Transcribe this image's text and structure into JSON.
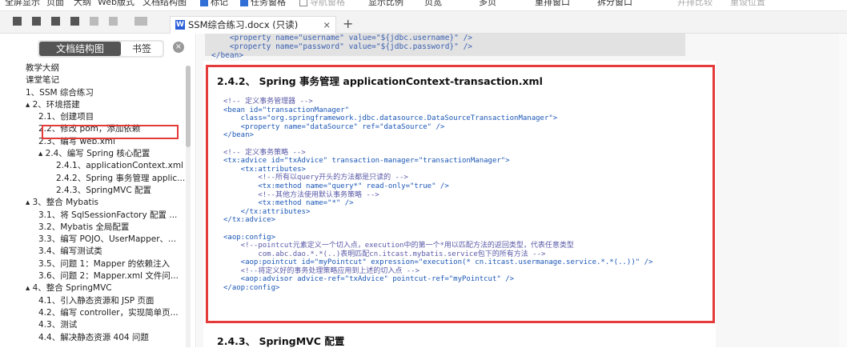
{
  "ribbon": {
    "items": [
      "全屏显示",
      "页面",
      "大纲",
      "Web版式",
      "文档结构图",
      "标记",
      "任务窗格",
      "导航窗格",
      "显示比例",
      "页宽",
      "多页",
      "重排窗口",
      "拆分窗口",
      "并排比较",
      "重设位置"
    ]
  },
  "tab": {
    "title": "SSM综合练习.docx (只读)",
    "close": "×",
    "add": "+"
  },
  "sidebar": {
    "seg_outline": "文档结构图",
    "seg_bookmark": "书签",
    "close": "×",
    "toc": [
      {
        "level": 1,
        "label": "教学大纲"
      },
      {
        "level": 1,
        "label": "课堂笔记"
      },
      {
        "level": 1,
        "label": "1、SSM 综合练习"
      },
      {
        "level": 1,
        "label": "▴ 2、环境搭建"
      },
      {
        "level": 2,
        "label": "2.1、创建项目"
      },
      {
        "level": 2,
        "label": "2.2、修改 pom，添加依赖"
      },
      {
        "level": 2,
        "label": "2.3、编写 web.xml"
      },
      {
        "level": 2,
        "label": "▴ 2.4、编写 Spring 核心配置"
      },
      {
        "level": 3,
        "label": "2.4.1、applicationContext.xml"
      },
      {
        "level": 3,
        "label": "2.4.2、Spring 事务管理 applic..."
      },
      {
        "level": 3,
        "label": "2.4.3、SpringMVC 配置"
      },
      {
        "level": 1,
        "label": "▴ 3、整合 Mybatis"
      },
      {
        "level": 2,
        "label": "3.1、将 SqlSessionFactory 配置 ..."
      },
      {
        "level": 2,
        "label": "3.2、Mybatis 全局配置"
      },
      {
        "level": 2,
        "label": "3.3、编写 POJO、UserMapper、..."
      },
      {
        "level": 2,
        "label": "3.4、编写测试类"
      },
      {
        "level": 2,
        "label": "3.5、问题 1：Mapper 的依赖注入"
      },
      {
        "level": 2,
        "label": "3.6、问题 2：Mapper.xml 文件问..."
      },
      {
        "level": 1,
        "label": "▴ 4、整合 SpringMVC"
      },
      {
        "level": 2,
        "label": "4.1、引入静态资源和 JSP 页面"
      },
      {
        "level": 2,
        "label": "4.2、编写 controller，实现简单页..."
      },
      {
        "level": 2,
        "label": "4.3、测试"
      },
      {
        "level": 2,
        "label": "4.4、解决静态资源 404 问题"
      }
    ]
  },
  "doc": {
    "top_lines": [
      "    <property name=\"username\" value=\"${jdbc.username}\" />",
      "    <property name=\"password\" value=\"${jdbc.password}\" />",
      "</bean>"
    ],
    "heading_242": "2.4.2、 Spring 事务管理 applicationContext-transaction.xml",
    "code_lines": [
      "<!-- 定义事务管理器 -->",
      "<bean id=\"transactionManager\"",
      "    class=\"org.springframework.jdbc.datasource.DataSourceTransactionManager\">",
      "    <property name=\"dataSource\" ref=\"dataSource\" />",
      "</bean>",
      "",
      "<!-- 定义事务策略 -->",
      "<tx:advice id=\"txAdvice\" transaction-manager=\"transactionManager\">",
      "    <tx:attributes>",
      "        <!--所有以query开头的方法都是只读的 -->",
      "        <tx:method name=\"query*\" read-only=\"true\" />",
      "        <!--其他方法使用默认事务策略 -->",
      "        <tx:method name=\"*\" />",
      "    </tx:attributes>",
      "</tx:advice>",
      "",
      "<aop:config>",
      "    <!--pointcut元素定义一个切入点，execution中的第一个*用以匹配方法的返回类型，代表任意类型",
      "        com.abc.dao.*.*(..)表明匹配cn.itcast.mybatis.service包下的所有方法 -->",
      "    <aop:pointcut id=\"myPointcut\" expression=\"execution(* cn.itcast.usermanage.service.*.*(..))\" />",
      "    <!--将定义好的事务处理策略应用到上述的切入点 -->",
      "    <aop:advisor advice-ref=\"txAdvice\" pointcut-ref=\"myPointcut\" />",
      "</aop:config>"
    ],
    "heading_243": "2.4.3、 SpringMVC 配置"
  }
}
